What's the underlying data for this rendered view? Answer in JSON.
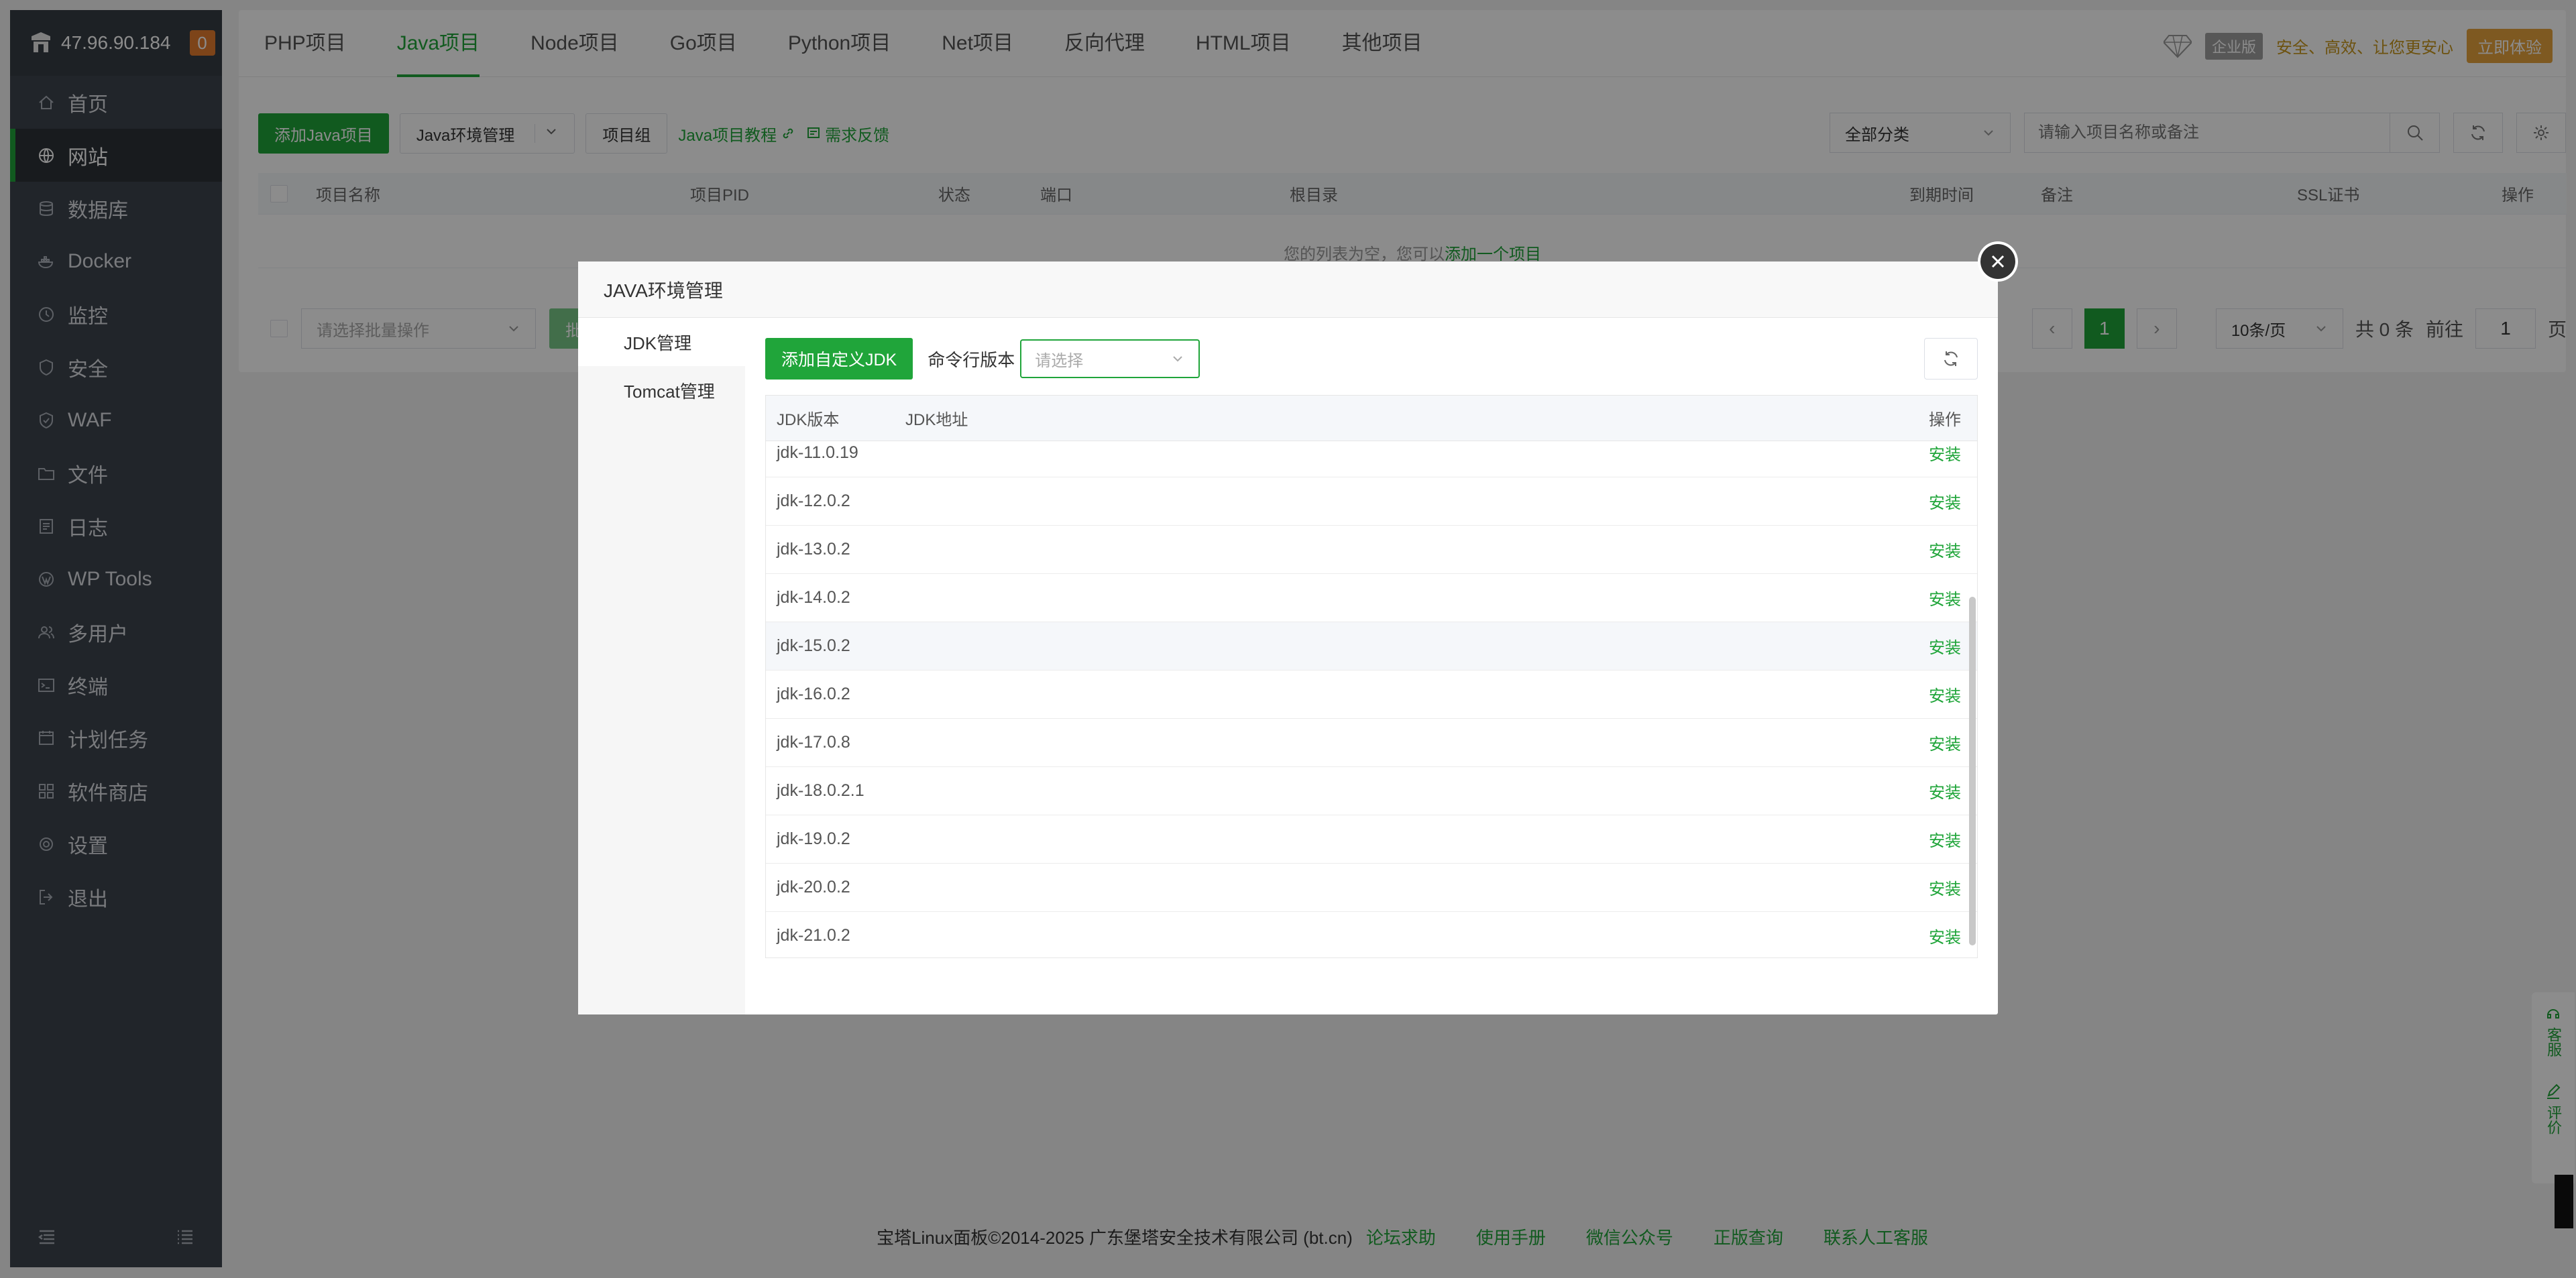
{
  "sidebar": {
    "ip": "47.96.90.184",
    "badge": "0",
    "items": [
      {
        "label": "首页",
        "icon": "home-icon"
      },
      {
        "label": "网站",
        "icon": "globe-icon",
        "active": true
      },
      {
        "label": "数据库",
        "icon": "database-icon"
      },
      {
        "label": "Docker",
        "icon": "docker-icon"
      },
      {
        "label": "监控",
        "icon": "monitor-icon"
      },
      {
        "label": "安全",
        "icon": "shield-icon"
      },
      {
        "label": "WAF",
        "icon": "waf-shield-icon"
      },
      {
        "label": "文件",
        "icon": "folder-icon"
      },
      {
        "label": "日志",
        "icon": "log-icon"
      },
      {
        "label": "WP Tools",
        "icon": "wordpress-icon"
      },
      {
        "label": "多用户",
        "icon": "users-icon"
      },
      {
        "label": "终端",
        "icon": "terminal-icon"
      },
      {
        "label": "计划任务",
        "icon": "clock-icon"
      },
      {
        "label": "软件商店",
        "icon": "grid-icon"
      },
      {
        "label": "设置",
        "icon": "gear-icon"
      },
      {
        "label": "退出",
        "icon": "logout-icon"
      }
    ]
  },
  "topnav": {
    "tabs": [
      "PHP项目",
      "Java项目",
      "Node项目",
      "Go项目",
      "Python项目",
      "Net项目",
      "反向代理",
      "HTML项目",
      "其他项目"
    ],
    "active_index": 1,
    "promo": {
      "edition": "企业版",
      "slogan": "安全、高效、让您更安心",
      "try": "立即体验"
    }
  },
  "toolbar": {
    "add_project": "添加Java项目",
    "env_manage": "Java环境管理",
    "project_group": "项目组",
    "tutorial": "Java项目教程",
    "feedback": "需求反馈",
    "category": "全部分类",
    "search_placeholder": "请输入项目名称或备注"
  },
  "table": {
    "headers": [
      "项目名称",
      "项目PID",
      "状态",
      "端口",
      "根目录",
      "到期时间",
      "备注",
      "SSL证书",
      "操作"
    ],
    "empty_text": "您的列表为空，您可以",
    "empty_link": "添加一个项目"
  },
  "pager": {
    "batch_placeholder": "请选择批量操作",
    "batch_button": "批量操作",
    "current_page": "1",
    "per_page": "10条/页",
    "total": "共 0 条",
    "goto_label": "前往",
    "goto_value": "1",
    "page_suffix": "页"
  },
  "modal": {
    "title": "JAVA环境管理",
    "tabs": [
      "JDK管理",
      "Tomcat管理"
    ],
    "add_jdk": "添加自定义JDK",
    "cmd_version_label": "命令行版本",
    "cmd_version_placeholder": "请选择",
    "columns": {
      "version": "JDK版本",
      "path": "JDK地址",
      "action": "操作"
    },
    "rows": [
      {
        "version": "jdk-11.0.19",
        "action": "安装"
      },
      {
        "version": "jdk-12.0.2",
        "action": "安装"
      },
      {
        "version": "jdk-13.0.2",
        "action": "安装"
      },
      {
        "version": "jdk-14.0.2",
        "action": "安装"
      },
      {
        "version": "jdk-15.0.2",
        "action": "安装"
      },
      {
        "version": "jdk-16.0.2",
        "action": "安装"
      },
      {
        "version": "jdk-17.0.8",
        "action": "安装"
      },
      {
        "version": "jdk-18.0.2.1",
        "action": "安装"
      },
      {
        "version": "jdk-19.0.2",
        "action": "安装"
      },
      {
        "version": "jdk-20.0.2",
        "action": "安装"
      },
      {
        "version": "jdk-21.0.2",
        "action": "安装"
      }
    ]
  },
  "footer": {
    "copyright": "宝塔Linux面板©2014-2025 广东堡塔安全技术有限公司 (bt.cn)",
    "links": [
      "论坛求助",
      "使用手册",
      "微信公众号",
      "正版查询",
      "联系人工客服"
    ]
  },
  "float": {
    "service": "客服",
    "review": "评价"
  },
  "colors": {
    "accent": "#20a53a",
    "sidebar": "#3c444d",
    "badge": "#e47d2f",
    "promo": "#c7961c"
  }
}
